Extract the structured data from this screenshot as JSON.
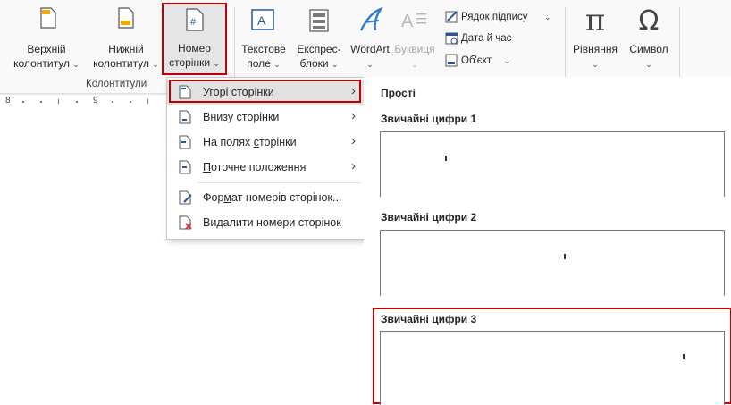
{
  "ribbon": {
    "buttons": {
      "header": {
        "line1": "Верхній",
        "line2": "колонтитул"
      },
      "footer": {
        "line1": "Нижній",
        "line2": "колонтитул"
      },
      "page_number": {
        "line1": "Номер",
        "line2": "сторінки"
      },
      "text_box": {
        "line1": "Текстове",
        "line2": "поле"
      },
      "quick_parts": {
        "line1": "Експрес-",
        "line2": "блоки"
      },
      "wordart": {
        "line1": "WordArt",
        "line2": ""
      },
      "drop_cap": {
        "line1": "Буквиця",
        "line2": ""
      },
      "signature_line": "Рядок підпису",
      "date_time": "Дата й час",
      "object": "Об'єкт",
      "equation": "Рівняння",
      "symbol": "Символ"
    },
    "group_label": "Колонтитули",
    "chevron": "⌄",
    "accent_color": "#2b579a",
    "highlight_color": "#c00000"
  },
  "ruler": {
    "marks": [
      "8",
      "9"
    ]
  },
  "menu": {
    "items": [
      {
        "pre": "",
        "u": "У",
        "post": "горі сторінки",
        "arrow": "›"
      },
      {
        "pre": "",
        "u": "В",
        "post": "низу сторінки",
        "arrow": "›"
      },
      {
        "pre": "На полях ",
        "u": "с",
        "post": "торінки",
        "arrow": "›"
      },
      {
        "pre": "",
        "u": "П",
        "post": "оточне положення",
        "arrow": "›"
      },
      {
        "pre": "Фор",
        "u": "м",
        "post": "ат номерів сторінок...",
        "arrow": ""
      },
      {
        "pre": "Ви",
        "u": "д",
        "post": "алити номери сторінок",
        "arrow": ""
      }
    ]
  },
  "gallery": {
    "section_title": "Прості",
    "items": [
      {
        "title": "Звичайні цифри 1",
        "tick": "left"
      },
      {
        "title": "Звичайні цифри 2",
        "tick": "center"
      },
      {
        "title": "Звичайні цифри 3",
        "tick": "right"
      }
    ]
  }
}
